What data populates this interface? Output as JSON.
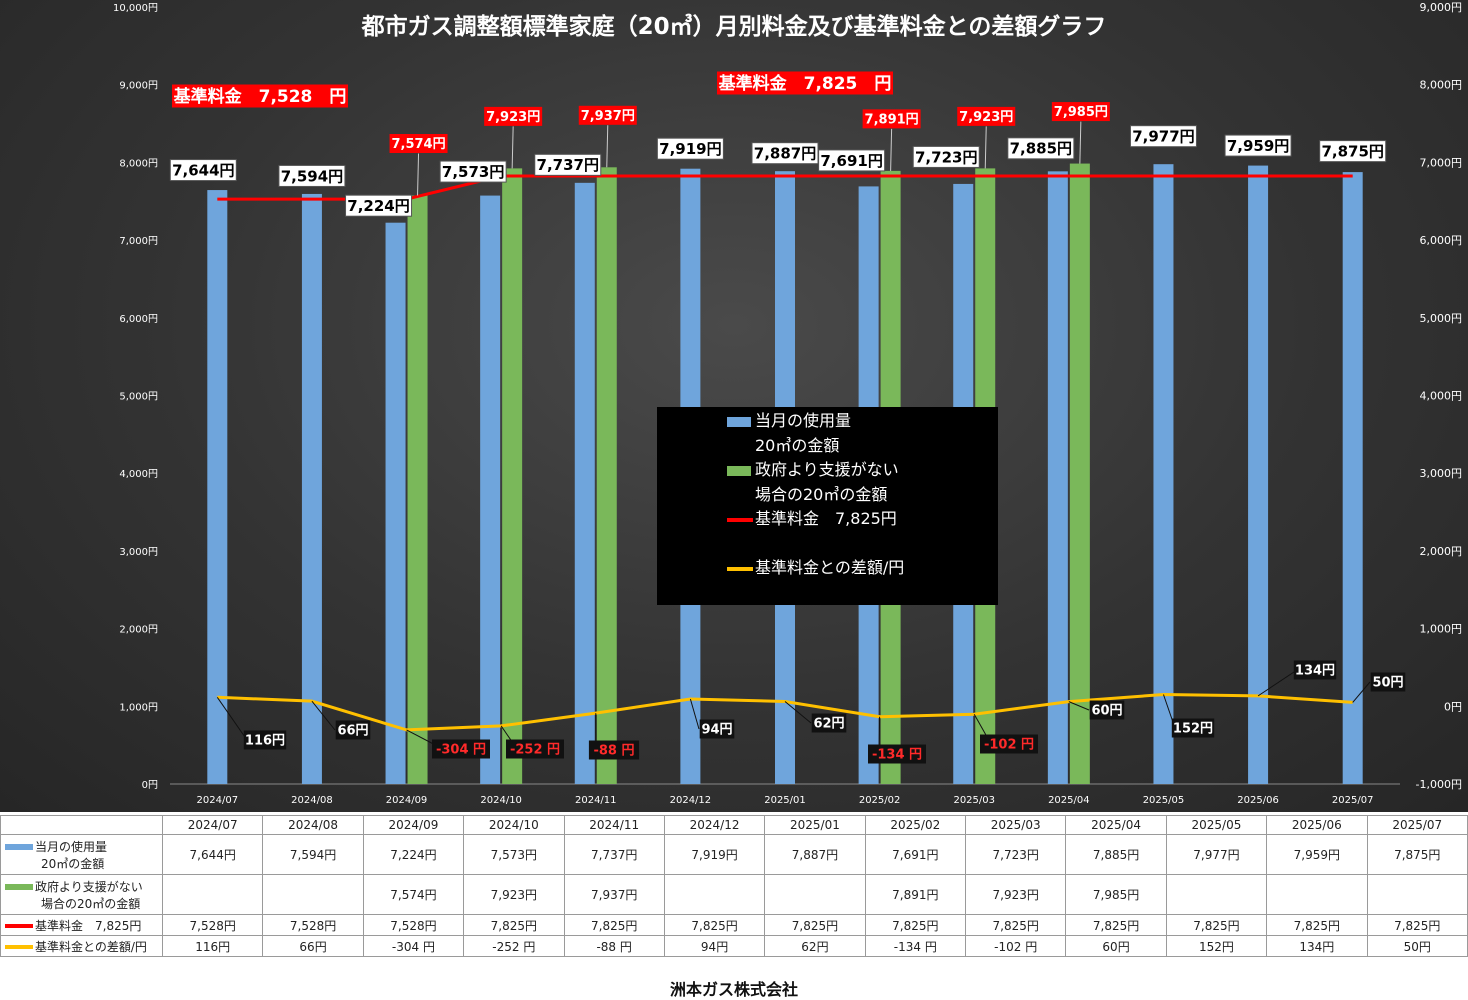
{
  "title": "都市ガス調整額標準家庭（20㎥）月別料金及び基準料金との差額グラフ",
  "company": "洲本ガス株式会社",
  "colors": {
    "blue": "#6fa5dc",
    "green": "#7ab85a",
    "red": "#ff0000",
    "yellow": "#ffc000",
    "label_bg": "#ffffff",
    "red_label_bg": "#ff0000",
    "diff_label_bg": "#111111"
  },
  "base_fee_labels": [
    "基準料金　7,528　円",
    "基準料金　7,825　円"
  ],
  "legend": {
    "blue_line1": "当月の使用量",
    "blue_line2": "20㎥の金額",
    "green_line1": "政府より支援がない",
    "green_line2": "場合の20㎥の金額",
    "red": "基準料金　7,825円",
    "yellow": "基準料金との差額/円"
  },
  "left_axis_ticks": [
    "0円",
    "1,000円",
    "2,000円",
    "3,000円",
    "4,000円",
    "5,000円",
    "6,000円",
    "7,000円",
    "8,000円",
    "9,000円",
    "10,000円"
  ],
  "right_axis_ticks": [
    "-1,000円",
    "0円",
    "1,000円",
    "2,000円",
    "3,000円",
    "4,000円",
    "5,000円",
    "6,000円",
    "7,000円",
    "8,000円",
    "9,000円"
  ],
  "chart_data": {
    "type": "bar",
    "title": "都市ガス調整額標準家庭（20㎥）月別料金及び基準料金との差額グラフ",
    "categories": [
      "2024/07",
      "2024/08",
      "2024/09",
      "2024/10",
      "2024/11",
      "2024/12",
      "2025/01",
      "2025/02",
      "2025/03",
      "2025/04",
      "2025/05",
      "2025/06",
      "2025/07"
    ],
    "ylim": [
      0,
      10000
    ],
    "y2lim": [
      -1000,
      9000
    ],
    "legend_position": "center",
    "series": [
      {
        "name": "当月の使用量 20㎥の金額",
        "type": "bar",
        "axis": "left",
        "values": [
          7644,
          7594,
          7224,
          7573,
          7737,
          7919,
          7887,
          7691,
          7723,
          7885,
          7977,
          7959,
          7875
        ],
        "labels": [
          "7,644円",
          "7,594円",
          "7,224円",
          "7,573円",
          "7,737円",
          "7,919円",
          "7,887円",
          "7,691円",
          "7,723円",
          "7,885円",
          "7,977円",
          "7,959円",
          "7,875円"
        ]
      },
      {
        "name": "政府より支援がない 場合の20㎥の金額",
        "type": "bar",
        "axis": "left",
        "values": [
          null,
          null,
          7574,
          7923,
          7937,
          null,
          null,
          7891,
          7923,
          7985,
          null,
          null,
          null
        ],
        "labels": [
          "",
          "",
          "7,574円",
          "7,923円",
          "7,937円",
          "",
          "",
          "7,891円",
          "7,923円",
          "7,985円",
          "",
          "",
          ""
        ]
      },
      {
        "name": "基準料金　7,825円",
        "type": "line",
        "axis": "left",
        "values": [
          7528,
          7528,
          7528,
          7825,
          7825,
          7825,
          7825,
          7825,
          7825,
          7825,
          7825,
          7825,
          7825
        ],
        "labels": [
          "7,528円",
          "7,528円",
          "7,528円",
          "7,825円",
          "7,825円",
          "7,825円",
          "7,825円",
          "7,825円",
          "7,825円",
          "7,825円",
          "7,825円",
          "7,825円",
          "7,825円"
        ]
      },
      {
        "name": "基準料金との差額/円",
        "type": "line",
        "axis": "right",
        "values": [
          116,
          66,
          -304,
          -252,
          -88,
          94,
          62,
          -134,
          -102,
          60,
          152,
          134,
          50
        ],
        "labels": [
          "116円",
          "66円",
          "-304 円",
          "-252 円",
          "-88 円",
          "94円",
          "62円",
          "-134 円",
          "-102 円",
          "60円",
          "152円",
          "134円",
          "50円"
        ]
      }
    ]
  },
  "table": {
    "row_labels": {
      "blue_line1": "当月の使用量",
      "blue_line2": "20㎥の金額",
      "green_line1": "政府より支援がない",
      "green_line2": "場合の20㎥の金額",
      "red": "基準料金　7,825円",
      "yellow": "基準料金との差額/円"
    }
  }
}
